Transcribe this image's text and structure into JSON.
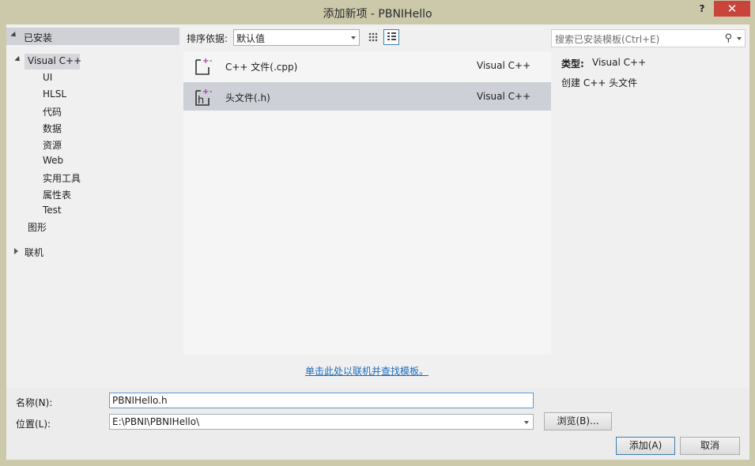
{
  "window": {
    "title": "添加新项 - PBNIHello",
    "help_label": "?",
    "close_label": "✕"
  },
  "tree": {
    "installed": "已安装",
    "visual_cpp": "Visual C++",
    "children": [
      "UI",
      "HLSL",
      "代码",
      "数据",
      "资源",
      "Web",
      "实用工具",
      "属性表",
      "Test"
    ],
    "graphics": "图形",
    "online": "联机"
  },
  "toolbar": {
    "sort_label": "排序依据:",
    "sort_value": "默认值",
    "view_mode": "list"
  },
  "templates": [
    {
      "name": "C++ 文件(.cpp)",
      "lang": "Visual C++",
      "icon": "cpp-file-icon",
      "selected": false
    },
    {
      "name": "头文件(.h)",
      "lang": "Visual C++",
      "icon": "header-file-icon",
      "selected": true
    }
  ],
  "online_link": "单击此处以联机并查找模板。",
  "search": {
    "placeholder": "搜索已安装模板(Ctrl+E)"
  },
  "details": {
    "type_label": "类型:",
    "type_value": "Visual C++",
    "description": "创建 C++ 头文件"
  },
  "form": {
    "name_label": "名称(N):",
    "name_value": "PBNIHello.h",
    "location_label": "位置(L):",
    "location_value": "E:\\PBNI\\PBNIHello\\",
    "browse_label": "浏览(B)...",
    "add_label": "添加(A)",
    "cancel_label": "取消"
  },
  "colors": {
    "accent": "#3c7fb1",
    "link": "#1a6bbb",
    "close": "#c9443b",
    "title_bar": "#ccc9ab"
  }
}
